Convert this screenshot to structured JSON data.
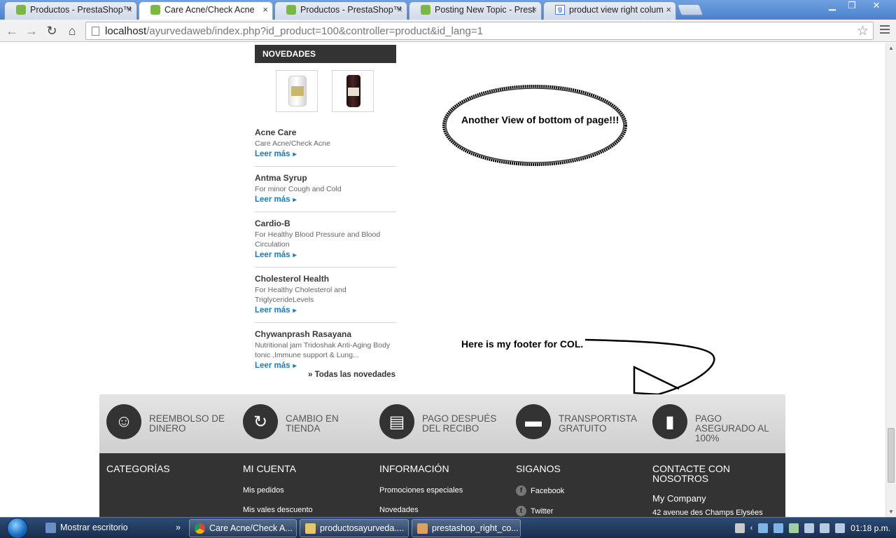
{
  "browser": {
    "tabs": [
      {
        "title": "Productos - PrestaShop™",
        "icon": "prestashop-icon",
        "active": false
      },
      {
        "title": "Care Acne/Check Acne",
        "icon": "prestashop-icon",
        "active": true
      },
      {
        "title": "Productos - PrestaShop™",
        "icon": "prestashop-icon",
        "active": false
      },
      {
        "title": "Posting New Topic - Prest",
        "icon": "prestashop-icon",
        "active": false
      },
      {
        "title": "product view right colum",
        "icon": "google-icon",
        "active": false
      }
    ],
    "url_host": "localhost",
    "url_path": "/ayurvedaweb/index.php?id_product=100&controller=product&id_lang=1"
  },
  "sidebar": {
    "block_title": "NOVEDADES",
    "products": [
      {
        "name": "Acne Care",
        "desc": "Care Acne/Check Acne",
        "more": "Leer más"
      },
      {
        "name": "Antma Syrup",
        "desc": "For minor Cough and Cold",
        "more": "Leer más"
      },
      {
        "name": "Cardio-B",
        "desc": "For Healthy Blood Pressure and Blood Circulation",
        "more": "Leer más"
      },
      {
        "name": "Cholesterol Health",
        "desc": "For Healthy Cholesterol and TriglycerideLevels",
        "more": "Leer más"
      },
      {
        "name": "Chywanprash Rasayana",
        "desc": "Nutritional jam Tridoshak Anti-Aging Body tonic ,Immune support & Lung...",
        "more": "Leer más"
      }
    ],
    "all_link": "» Todas las novedades"
  },
  "annotations": {
    "note_top": "Another View of bottom of page!!!",
    "note_bottom": "Here is my footer for COL."
  },
  "reassurance": [
    {
      "label": "REEMBOLSO DE DINERO",
      "icon": "smiley-icon",
      "glyph": "☺"
    },
    {
      "label": "CAMBIO EN TIENDA",
      "icon": "refresh-icon",
      "glyph": "↻"
    },
    {
      "label": "PAGO DESPUÉS DEL RECIBO",
      "icon": "receipt-icon",
      "glyph": "▤"
    },
    {
      "label": "TRANSPORTISTA GRATUITO",
      "icon": "truck-icon",
      "glyph": "▬"
    },
    {
      "label": "PAGO ASEGURADO AL 100%",
      "icon": "lock-icon",
      "glyph": "▮"
    }
  ],
  "footer": {
    "categories_title": "CATEGORÍAS",
    "account_title": "MI CUENTA",
    "account_links": [
      "Mis pedidos",
      "Mis vales descuento"
    ],
    "info_title": "INFORMACIÓN",
    "info_links": [
      "Promociones especiales",
      "Novedades"
    ],
    "follow_title": "SIGANOS",
    "social": [
      {
        "label": "Facebook",
        "icon": "facebook-icon",
        "glyph": "f"
      },
      {
        "label": "Twitter",
        "icon": "twitter-icon",
        "glyph": "t"
      }
    ],
    "contact_title": "CONTACTE CON NOSOTROS",
    "company": "My Company",
    "address": "42 avenue des Champs Elysées"
  },
  "taskbar": {
    "show_desktop": "Mostrar escritorio",
    "items": [
      "Care Acne/Check A...",
      "productosayurveda....",
      "prestashop_right_co..."
    ],
    "clock": "01:18 p.m."
  },
  "colors": {
    "dark": "#333333",
    "link": "#1c7ab9",
    "band": "#d8d8d8"
  }
}
